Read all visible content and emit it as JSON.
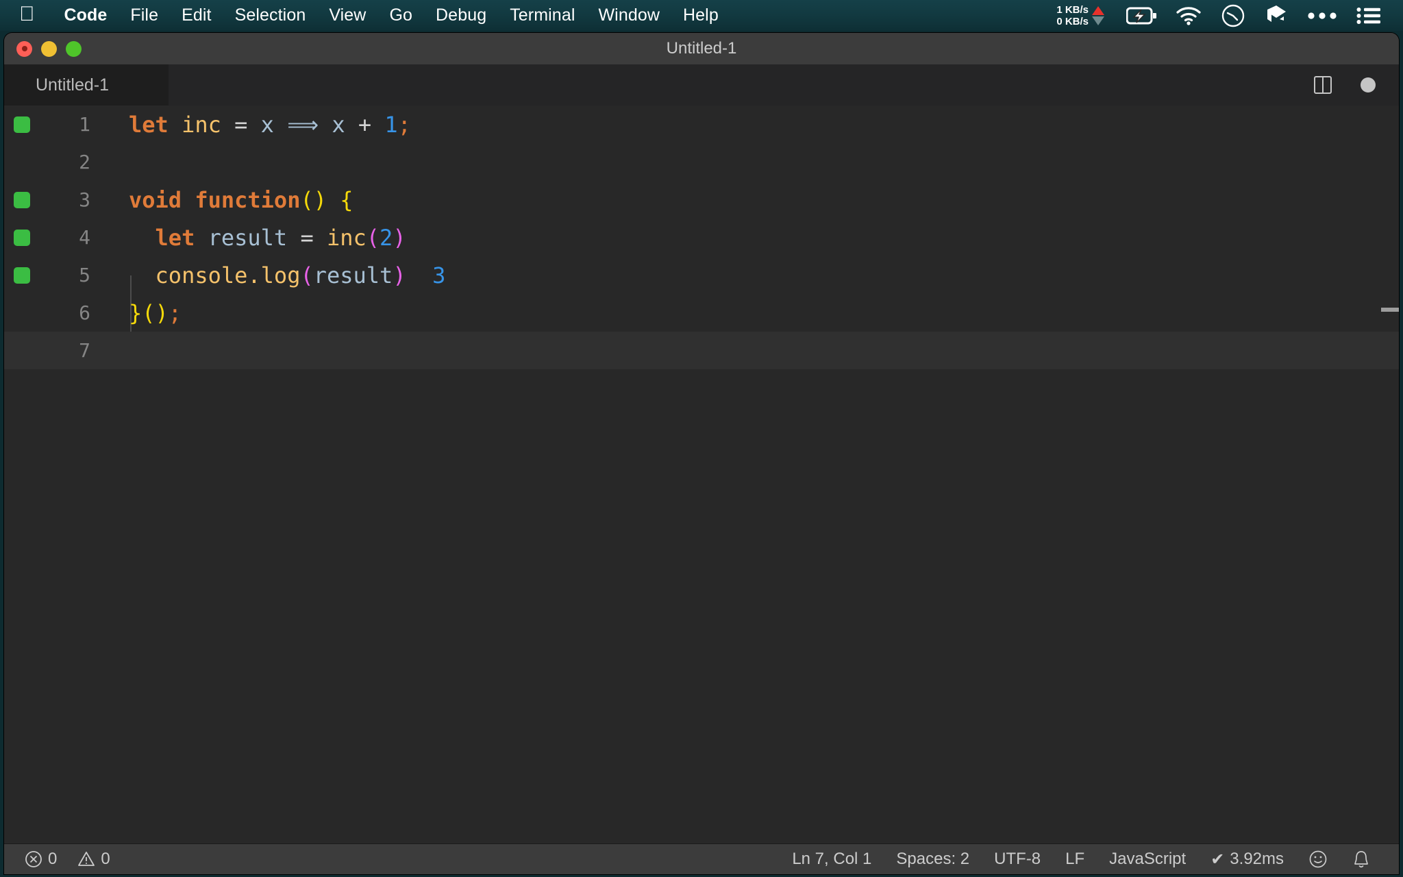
{
  "menubar": {
    "apple_icon": "apple-logo-icon",
    "items": [
      {
        "label": "Code",
        "bold": true
      },
      {
        "label": "File",
        "bold": false
      },
      {
        "label": "Edit",
        "bold": false
      },
      {
        "label": "Selection",
        "bold": false
      },
      {
        "label": "View",
        "bold": false
      },
      {
        "label": "Go",
        "bold": false
      },
      {
        "label": "Debug",
        "bold": false
      },
      {
        "label": "Terminal",
        "bold": false
      },
      {
        "label": "Window",
        "bold": false
      },
      {
        "label": "Help",
        "bold": false
      }
    ],
    "tray": {
      "upload_speed": "1 KB/s",
      "download_speed": "0 KB/s",
      "upload_arrow_color": "#e8312b",
      "download_arrow_color": "#6f8a8e",
      "icons": [
        "battery-charging-icon",
        "wifi-icon",
        "clock-icon",
        "dropbox-icon",
        "ellipsis-icon",
        "control-center-list-icon"
      ]
    }
  },
  "window": {
    "title": "Untitled-1",
    "traffic_lights": [
      {
        "name": "close-button",
        "color": "#ff5f57"
      },
      {
        "name": "minimize-button",
        "color": "#f0c033"
      },
      {
        "name": "maximize-button",
        "color": "#4fc52a"
      }
    ]
  },
  "tabbar": {
    "active_tab": "Untitled-1",
    "actions": [
      "split-editor-icon",
      "unsaved-dot-icon"
    ]
  },
  "editor": {
    "language": "JavaScript",
    "lines": [
      {
        "number": "1",
        "gutter_marker": true,
        "current": false,
        "tokens": [
          {
            "text": "let",
            "cls": "t-key"
          },
          {
            "text": " ",
            "cls": "t-op"
          },
          {
            "text": "inc",
            "cls": "t-fn"
          },
          {
            "text": " ",
            "cls": "t-op"
          },
          {
            "text": "=",
            "cls": "t-op"
          },
          {
            "text": " ",
            "cls": "t-op"
          },
          {
            "text": "x",
            "cls": "t-var"
          },
          {
            "text": " ",
            "cls": "t-op"
          },
          {
            "text": "⟹",
            "cls": "t-var"
          },
          {
            "text": " ",
            "cls": "t-op"
          },
          {
            "text": "x",
            "cls": "t-var"
          },
          {
            "text": " ",
            "cls": "t-op"
          },
          {
            "text": "+",
            "cls": "t-op"
          },
          {
            "text": " ",
            "cls": "t-op"
          },
          {
            "text": "1",
            "cls": "t-num"
          },
          {
            "text": ";",
            "cls": "t-punct"
          }
        ]
      },
      {
        "number": "2",
        "gutter_marker": false,
        "current": false,
        "tokens": []
      },
      {
        "number": "3",
        "gutter_marker": true,
        "current": false,
        "tokens": [
          {
            "text": "void",
            "cls": "t-key"
          },
          {
            "text": " ",
            "cls": "t-op"
          },
          {
            "text": "function",
            "cls": "t-key"
          },
          {
            "text": "()",
            "cls": "t-paren-y"
          },
          {
            "text": " ",
            "cls": "t-op"
          },
          {
            "text": "{",
            "cls": "t-paren-y"
          }
        ]
      },
      {
        "number": "4",
        "gutter_marker": true,
        "current": false,
        "tokens": [
          {
            "text": "  ",
            "cls": "t-op"
          },
          {
            "text": "let",
            "cls": "t-key"
          },
          {
            "text": " ",
            "cls": "t-op"
          },
          {
            "text": "result",
            "cls": "t-var"
          },
          {
            "text": " ",
            "cls": "t-op"
          },
          {
            "text": "=",
            "cls": "t-op"
          },
          {
            "text": " ",
            "cls": "t-op"
          },
          {
            "text": "inc",
            "cls": "t-fn"
          },
          {
            "text": "(",
            "cls": "t-paren-m"
          },
          {
            "text": "2",
            "cls": "t-num"
          },
          {
            "text": ")",
            "cls": "t-paren-m"
          }
        ]
      },
      {
        "number": "5",
        "gutter_marker": true,
        "current": false,
        "tokens": [
          {
            "text": "  ",
            "cls": "t-op"
          },
          {
            "text": "console",
            "cls": "t-fn"
          },
          {
            "text": ".",
            "cls": "t-fn"
          },
          {
            "text": "log",
            "cls": "t-fn"
          },
          {
            "text": "(",
            "cls": "t-paren-m"
          },
          {
            "text": "result",
            "cls": "t-var"
          },
          {
            "text": ")",
            "cls": "t-paren-m"
          },
          {
            "text": "  ",
            "cls": "t-op"
          },
          {
            "text": "3",
            "cls": "t-inline"
          }
        ]
      },
      {
        "number": "6",
        "gutter_marker": false,
        "current": false,
        "tokens": [
          {
            "text": "}",
            "cls": "t-paren-y"
          },
          {
            "text": "()",
            "cls": "t-paren-y"
          },
          {
            "text": ";",
            "cls": "t-punct"
          }
        ]
      },
      {
        "number": "7",
        "gutter_marker": false,
        "current": true,
        "tokens": []
      }
    ]
  },
  "statusbar": {
    "errors_icon": "error-circle-icon",
    "errors_count": "0",
    "warnings_icon": "warning-triangle-icon",
    "warnings_count": "0",
    "cursor_position": "Ln 7, Col 1",
    "indentation": "Spaces: 2",
    "encoding": "UTF-8",
    "eol": "LF",
    "language_mode": "JavaScript",
    "run_time": "3.92ms",
    "run_check_glyph": "✔",
    "feedback_icon": "smiley-icon",
    "notifications_icon": "bell-icon"
  },
  "colors": {
    "menubar_bg": "#123a41",
    "titlebar_bg": "#3c3c3c",
    "tabbar_bg": "#252526",
    "editor_bg": "#282828",
    "statusbar_bg": "#3c3c3c",
    "gutter_marker": "#3bbd43",
    "keyword": "#e07b39",
    "function": "#f5c26b",
    "variable": "#a8c0d4",
    "number": "#3794e8",
    "bracket_yellow": "#f5d90a",
    "bracket_magenta": "#e862e8"
  }
}
